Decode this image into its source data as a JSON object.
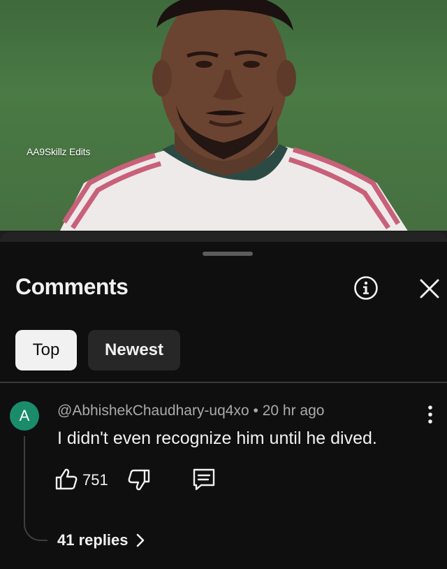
{
  "video": {
    "watermark": "AA9Skillz Edits"
  },
  "comments_panel": {
    "title": "Comments",
    "icons": {
      "info": "info-icon",
      "close": "close-icon"
    },
    "sort_chips": [
      {
        "label": "Top",
        "selected": true
      },
      {
        "label": "Newest",
        "selected": false
      }
    ]
  },
  "comment": {
    "avatar_letter": "A",
    "avatar_color": "#1a8c6a",
    "author": "@AbhishekChaudhary-uq4xo",
    "separator": "•",
    "time": "20 hr ago",
    "text": "I didn't even recognize him until he dived.",
    "likes": "751",
    "replies_label": "41 replies"
  },
  "colors": {
    "background": "#0f0f0f",
    "chip_selected_bg": "#f1f1f1",
    "chip_bg": "#272727",
    "secondary_text": "#aaaaaa"
  }
}
